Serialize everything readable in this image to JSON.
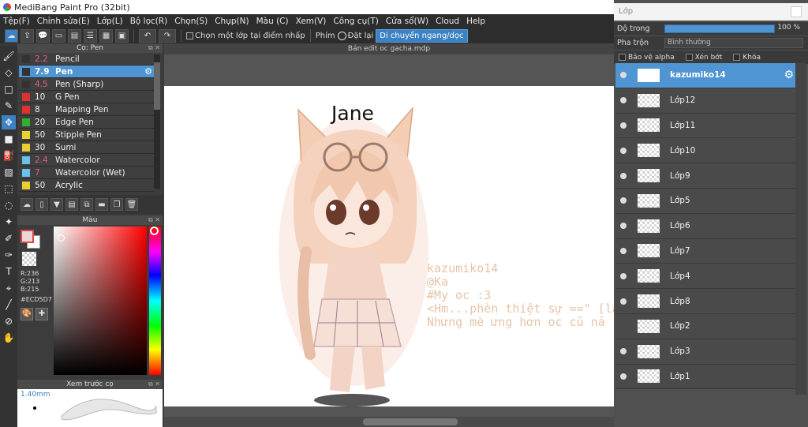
{
  "window": {
    "title": "MediBang Paint Pro (32bit)"
  },
  "menu": [
    "Tệp(F)",
    "Chỉnh sửa(E)",
    "Lớp(L)",
    "Bộ lọc(R)",
    "Chọn(S)",
    "Chụp(N)",
    "Màu (C)",
    "Xem(V)",
    "Công cụ(T)",
    "Cửa sổ(W)",
    "Cloud",
    "Help"
  ],
  "toolbar": {
    "select_layer_label": "Chọn một lớp tại điểm nhấp",
    "key_label": "Phím",
    "reset_label": "Đặt lại",
    "flip_label": "Di chuyển ngang/dọc"
  },
  "brush_panel": {
    "title": "Cọ: Pen",
    "items": [
      {
        "size": "2.2",
        "name": "Pencil",
        "color": "#333333",
        "size_color": "#e0607a"
      },
      {
        "size": "7.9",
        "name": "Pen",
        "color": "#333333",
        "size_color": "#ffffff",
        "selected": true
      },
      {
        "size": "4.5",
        "name": "Pen (Sharp)",
        "color": "#333333",
        "size_color": "#e0607a"
      },
      {
        "size": "10",
        "name": "G Pen",
        "color": "#e03030",
        "size_color": "#f0f0f0"
      },
      {
        "size": "8",
        "name": "Mapping Pen",
        "color": "#e03030",
        "size_color": "#f0f0f0"
      },
      {
        "size": "20",
        "name": "Edge Pen",
        "color": "#30b030",
        "size_color": "#f0f0f0"
      },
      {
        "size": "50",
        "name": "Stipple Pen",
        "color": "#e8d030",
        "size_color": "#f0f0f0"
      },
      {
        "size": "30",
        "name": "Sumi",
        "color": "#e8d030",
        "size_color": "#f0f0f0"
      },
      {
        "size": "2.4",
        "name": "Watercolor",
        "color": "#6ac0ee",
        "size_color": "#e0607a"
      },
      {
        "size": "7",
        "name": "Watercolor (Wet)",
        "color": "#6ac0ee",
        "size_color": "#e0607a"
      },
      {
        "size": "50",
        "name": "Acrylic",
        "color": "#e8d030",
        "size_color": "#f0f0f0"
      }
    ]
  },
  "color_panel": {
    "title": "Màu",
    "r": "R:236",
    "g": "G:213",
    "b": "B:215",
    "hex": "#ECD5D7"
  },
  "preview_panel": {
    "title": "Xem trước cọ",
    "size": "1.40mm"
  },
  "canvas": {
    "tab_title": "Bản edit oc gacha.mdp",
    "char_name": "Jane",
    "lines": [
      "kazumiko14",
      "@Ka",
      "#My oc :3",
      "<Hm...phèn thiệt sự ==\" [lần",
      "Nhưng mè ưng hơn oc cũ nả"
    ]
  },
  "layer_panel": {
    "title": "Lớp",
    "opacity_label": "Độ trong",
    "opacity_value": "100 %",
    "opacity_fraction": 1.0,
    "blend_label": "Pha trộn",
    "blend_value": "Bình thường",
    "protect_alpha": "Bảo vệ alpha",
    "clipping": "Xén bớt",
    "lock": "Khóa",
    "layers": [
      {
        "name": "kazumiko14",
        "visible": true,
        "selected": true
      },
      {
        "name": "Lớp12",
        "visible": true
      },
      {
        "name": "Lớp11",
        "visible": true
      },
      {
        "name": "Lớp10",
        "visible": true
      },
      {
        "name": "Lớp9",
        "visible": true
      },
      {
        "name": "Lớp5",
        "visible": true
      },
      {
        "name": "Lớp6",
        "visible": true
      },
      {
        "name": "Lớp7",
        "visible": true
      },
      {
        "name": "Lớp4",
        "visible": true
      },
      {
        "name": "Lớp8",
        "visible": true
      },
      {
        "name": "Lớp2",
        "visible": false
      },
      {
        "name": "Lớp3",
        "visible": true
      },
      {
        "name": "Lớp1",
        "visible": true
      }
    ]
  }
}
